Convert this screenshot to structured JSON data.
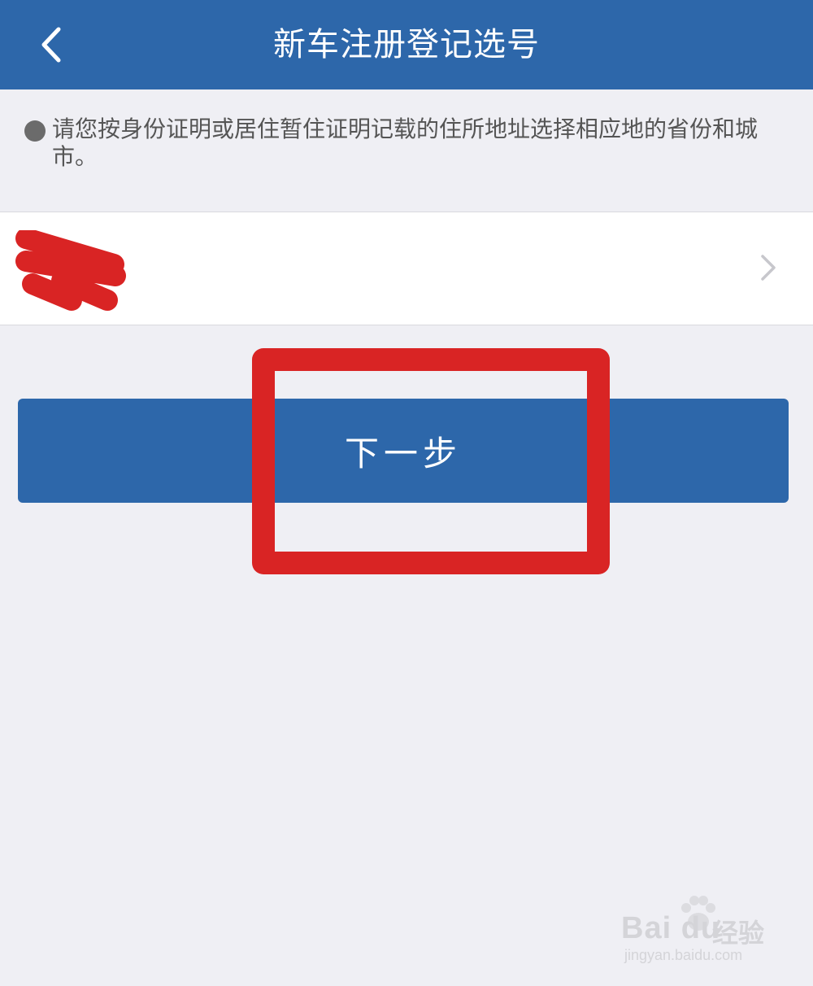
{
  "header": {
    "title": "新车注册登记选号",
    "back_icon": "chevron-left-icon"
  },
  "notice": {
    "bullet_icon": "bullet-dot-icon",
    "text": "请您按身份证明或居住暂住证明记载的住所地址选择相应地的省份和城市。"
  },
  "region_selector": {
    "chevron_icon": "chevron-right-icon"
  },
  "next_button": {
    "label": "下一步"
  },
  "annotation": {
    "color": "#d92424"
  },
  "watermark": {
    "brand": "Bai du",
    "product": "经验",
    "url": "jingyan.baidu.com"
  },
  "colors": {
    "primary": "#2d67aa",
    "background": "#efeff4",
    "surface": "#ffffff"
  }
}
